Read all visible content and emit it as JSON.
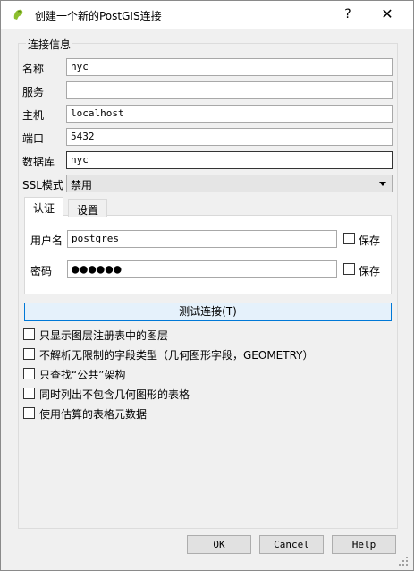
{
  "window": {
    "title": "创建一个新的PostGIS连接",
    "help_glyph": "?",
    "close_glyph": "✕",
    "icon": "qgis-elephant-icon"
  },
  "group": {
    "title": "连接信息"
  },
  "fields": {
    "name": {
      "label": "名称",
      "value": "nyc"
    },
    "service": {
      "label": "服务",
      "value": ""
    },
    "host": {
      "label": "主机",
      "value": "localhost"
    },
    "port": {
      "label": "端口",
      "value": "5432"
    },
    "database": {
      "label": "数据库",
      "value": "nyc"
    },
    "ssl": {
      "label": "SSL模式",
      "value": "禁用"
    }
  },
  "tabs": {
    "auth": "认证",
    "settings": "设置"
  },
  "auth": {
    "user_label": "用户名",
    "user_value": "postgres",
    "password_label": "密码",
    "password_value": "●●●●●●",
    "save_label": "保存"
  },
  "test_button": "测试连接(T)",
  "options": [
    "只显示图层注册表中的图层",
    "不解析无限制的字段类型（几何图形字段，GEOMETRY）",
    "只查找“公共”架构",
    "同时列出不包含几何图形的表格",
    "使用估算的表格元数据"
  ],
  "buttons": {
    "ok": "OK",
    "cancel": "Cancel",
    "help": "Help"
  },
  "colors": {
    "focus_border": "#0078d7",
    "window_bg": "#f0f0f0"
  }
}
